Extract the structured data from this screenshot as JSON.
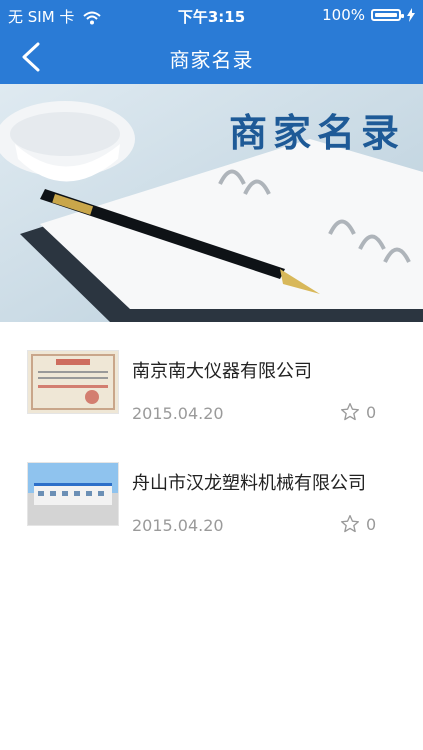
{
  "statusbar": {
    "carrier": "无 SIM 卡",
    "time": "下午3:15",
    "battery": "100%"
  },
  "navbar": {
    "title": "商家名录"
  },
  "banner": {
    "text": "商家名录"
  },
  "items": [
    {
      "name": "南京南大仪器有限公司",
      "date": "2015.04.20",
      "favorites": "0"
    },
    {
      "name": "舟山市汉龙塑料机械有限公司",
      "date": "2015.04.20",
      "favorites": "0"
    }
  ]
}
